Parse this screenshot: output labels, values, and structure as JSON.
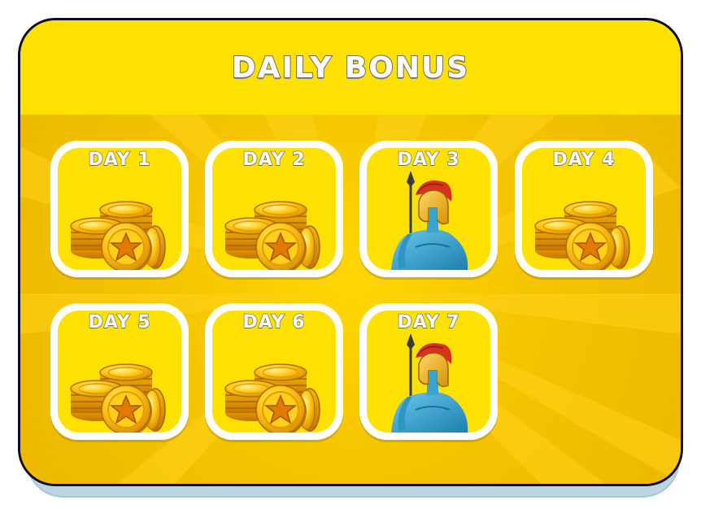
{
  "title": "DAILY BONUS",
  "days": [
    {
      "label": "DAY 1",
      "reward": "coins-icon"
    },
    {
      "label": "DAY 2",
      "reward": "coins-icon"
    },
    {
      "label": "DAY 3",
      "reward": "spartan-warrior-icon"
    },
    {
      "label": "DAY 4",
      "reward": "coins-icon"
    },
    {
      "label": "DAY 5",
      "reward": "coins-icon"
    },
    {
      "label": "DAY 6",
      "reward": "coins-icon"
    },
    {
      "label": "DAY 7",
      "reward": "spartan-warrior-icon"
    }
  ],
  "colors": {
    "panel_header": "#ffe100",
    "panel_body": "#f5c500",
    "panel_border": "#0c0c2a",
    "card_border": "#ffffff",
    "coin_gold": "#f5b000",
    "warrior_blue": "#3aa6d0",
    "helmet_crest": "#d8321c"
  }
}
